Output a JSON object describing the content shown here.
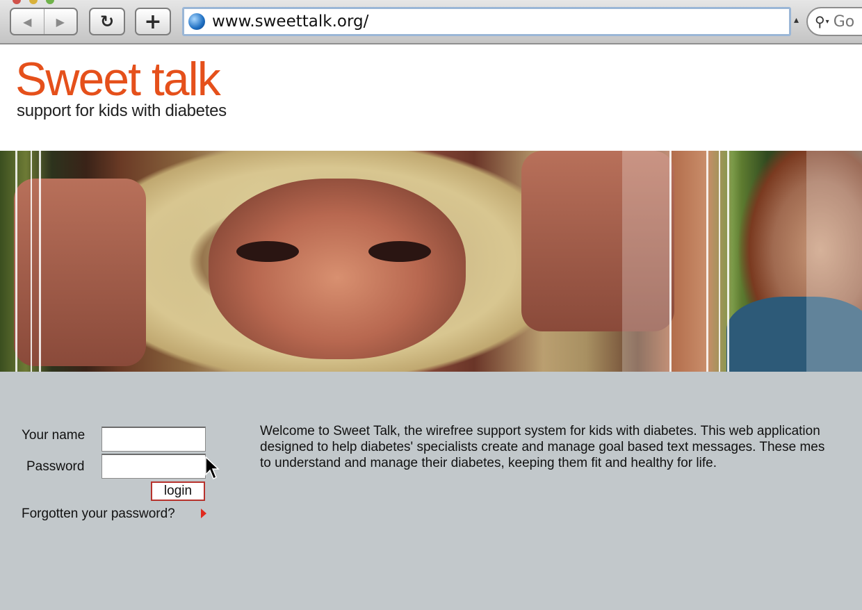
{
  "browser": {
    "url": "www.sweettalk.org/",
    "search_placeholder": "Go",
    "back_icon": "◀",
    "forward_icon": "▶",
    "reload_icon": "↻",
    "new_tab_icon": "+"
  },
  "header": {
    "title": "Sweet talk",
    "tagline": "support for kids with diabetes",
    "brand_color": "#e5501b"
  },
  "login": {
    "name_label": "Your name",
    "password_label": "Password",
    "name_value": "",
    "password_value": "",
    "button_label": "login",
    "forgot_label": "Forgotten your password?"
  },
  "welcome": {
    "lines": [
      "Welcome to Sweet Talk, the wirefree support system for kids with diabetes. This web application",
      "designed to help diabetes' specialists create and manage goal based text messages. These mes",
      "to understand and manage their diabetes, keeping them fit and healthy for life."
    ]
  },
  "colors": {
    "panel_background": "#c2c8cb",
    "button_border": "#b7322c",
    "arrow": "#e02a1f"
  }
}
